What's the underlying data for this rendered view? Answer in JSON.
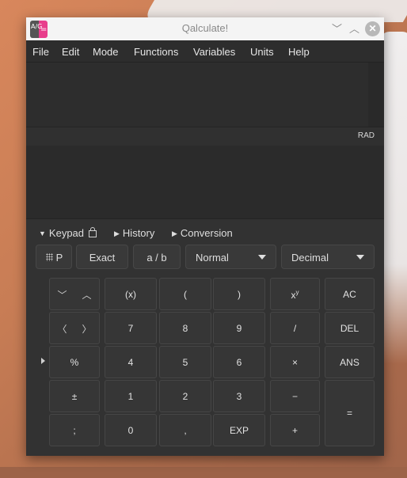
{
  "window": {
    "title": "Qalculate!",
    "icon_label_left": "A/G",
    "icon_label_right": "="
  },
  "titlebar": {
    "minimize_glyph": "﹀",
    "maximize_glyph": "︿",
    "close_glyph": "✕"
  },
  "menu": [
    "File",
    "Edit",
    "Mode",
    "Functions",
    "Variables",
    "Units",
    "Help"
  ],
  "status": {
    "angle_unit": "RAD"
  },
  "expanders": {
    "keypad": "Keypad",
    "history": "History",
    "conversion": "Conversion"
  },
  "toolbar": {
    "programming_label": "P",
    "exact_label": "Exact",
    "fraction_label": "a / b",
    "mode_select": "Normal",
    "base_select": "Decimal"
  },
  "keypad": {
    "up_down": {
      "down": "﹀",
      "up": "︿"
    },
    "left_right": {
      "left": "〈",
      "right": "〉"
    },
    "percent": "%",
    "plus_minus": "±",
    "semicolon": ";",
    "paren_x": "(x)",
    "open_paren": "(",
    "close_paren": ")",
    "power_base": "x",
    "power_exp": "y",
    "divide": "/",
    "multiply": "×",
    "minus": "−",
    "plus": "+",
    "equals": "=",
    "ac": "AC",
    "del": "DEL",
    "ans": "ANS",
    "digits": {
      "0": "0",
      "1": "1",
      "2": "2",
      "3": "3",
      "4": "4",
      "5": "5",
      "6": "6",
      "7": "7",
      "8": "8",
      "9": "9"
    },
    "decimal": ",",
    "exp": "EXP"
  }
}
